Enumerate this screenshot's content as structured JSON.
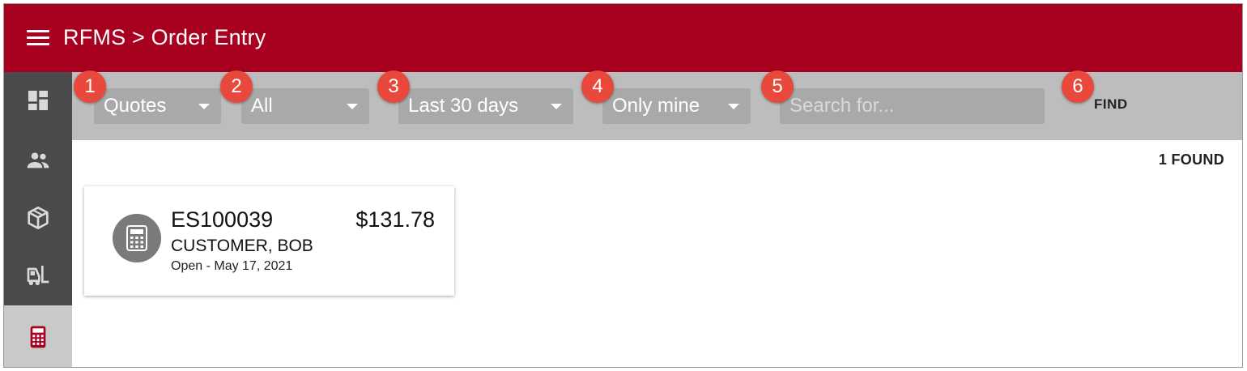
{
  "app": {
    "title": "RFMS > Order Entry"
  },
  "sidenav": {
    "items": [
      {
        "icon": "dashboard-icon",
        "active": false
      },
      {
        "icon": "people-icon",
        "active": false
      },
      {
        "icon": "package-icon",
        "active": false
      },
      {
        "icon": "forklift-icon",
        "active": false
      },
      {
        "icon": "calculator-icon",
        "active": true
      }
    ]
  },
  "filters": {
    "document_type": "Quotes",
    "status": "All",
    "date_range": "Last 30 days",
    "owner": "Only mine",
    "search_placeholder": "Search for...",
    "search_value": "",
    "find_label": "FIND"
  },
  "badges": [
    "1",
    "2",
    "3",
    "4",
    "5",
    "6"
  ],
  "results": {
    "count_label": "1 FOUND",
    "items": [
      {
        "id": "ES100039",
        "amount": "$131.78",
        "customer": "CUSTOMER, BOB",
        "status": "Open - May 17, 2021",
        "icon": "calculator-icon"
      }
    ]
  },
  "colors": {
    "brand": "#a8001f",
    "sidenav": "#4a4a4c",
    "badge": "#e8493c",
    "filterbar": "#bdbdbd"
  }
}
